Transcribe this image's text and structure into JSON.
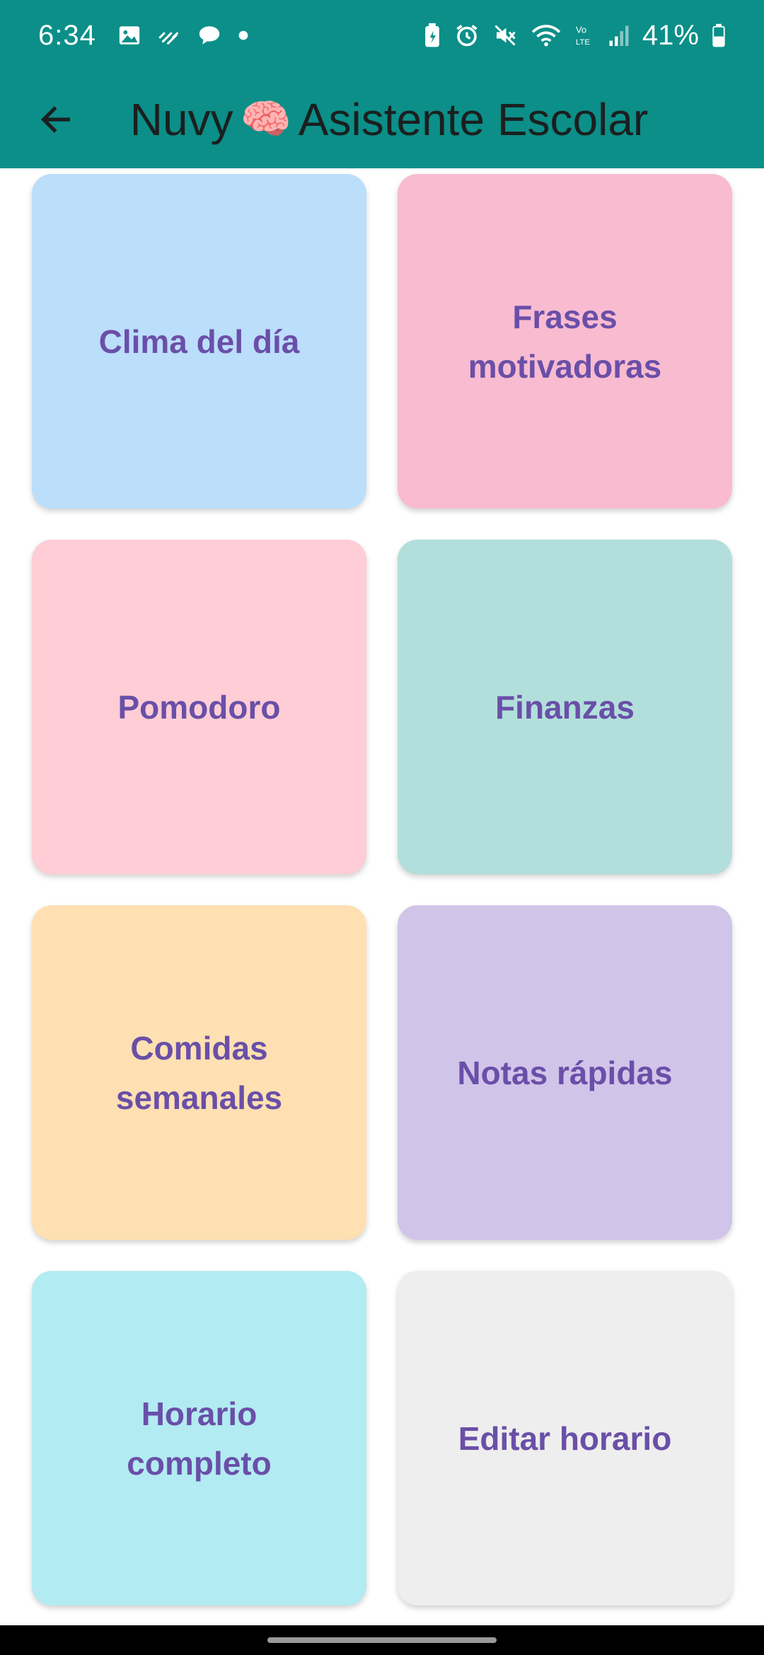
{
  "status_bar": {
    "time": "6:34",
    "battery": "41%",
    "left_icons": [
      "image-icon",
      "data-activity-icon",
      "chat-bubble-icon",
      "dot-icon"
    ],
    "right_icons": [
      "battery-saver-icon",
      "alarm-icon",
      "mute-icon",
      "wifi-icon",
      "volte-icon",
      "signal-icon",
      "battery-icon"
    ]
  },
  "app_bar": {
    "title_prefix": "Nuvy",
    "title_emoji": "🧠",
    "title_suffix": "Asistente Escolar",
    "background": "#0b8f88"
  },
  "tiles": [
    {
      "label": "Clima del día",
      "color": "#bbdefb"
    },
    {
      "label": "Frases\nmotivadoras",
      "color": "#f8bbd0"
    },
    {
      "label": "Pomodoro",
      "color": "#ffcdd5"
    },
    {
      "label": "Finanzas",
      "color": "#b2dfdb"
    },
    {
      "label": "Comidas\nsemanales",
      "color": "#ffe0b2"
    },
    {
      "label": "Notas rápidas",
      "color": "#d1c4e9"
    },
    {
      "label": "Horario\ncompleto",
      "color": "#b2ebf2"
    },
    {
      "label": "Editar horario",
      "color": "#eeeeee"
    }
  ],
  "accent_text_color": "#6a4fa8"
}
